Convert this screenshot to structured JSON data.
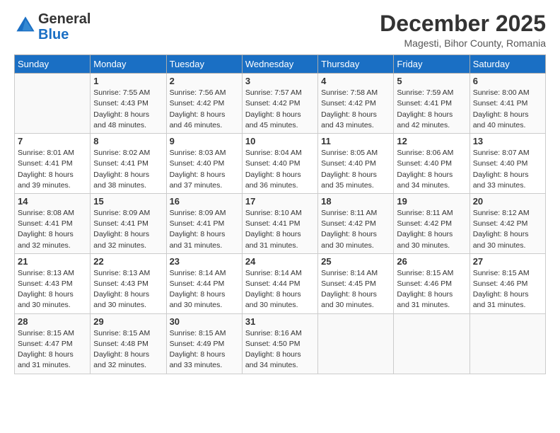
{
  "header": {
    "logo_line1": "General",
    "logo_line2": "Blue",
    "month_title": "December 2025",
    "subtitle": "Magesti, Bihor County, Romania"
  },
  "weekdays": [
    "Sunday",
    "Monday",
    "Tuesday",
    "Wednesday",
    "Thursday",
    "Friday",
    "Saturday"
  ],
  "weeks": [
    [
      {
        "day": "",
        "info": ""
      },
      {
        "day": "1",
        "info": "Sunrise: 7:55 AM\nSunset: 4:43 PM\nDaylight: 8 hours\nand 48 minutes."
      },
      {
        "day": "2",
        "info": "Sunrise: 7:56 AM\nSunset: 4:42 PM\nDaylight: 8 hours\nand 46 minutes."
      },
      {
        "day": "3",
        "info": "Sunrise: 7:57 AM\nSunset: 4:42 PM\nDaylight: 8 hours\nand 45 minutes."
      },
      {
        "day": "4",
        "info": "Sunrise: 7:58 AM\nSunset: 4:42 PM\nDaylight: 8 hours\nand 43 minutes."
      },
      {
        "day": "5",
        "info": "Sunrise: 7:59 AM\nSunset: 4:41 PM\nDaylight: 8 hours\nand 42 minutes."
      },
      {
        "day": "6",
        "info": "Sunrise: 8:00 AM\nSunset: 4:41 PM\nDaylight: 8 hours\nand 40 minutes."
      }
    ],
    [
      {
        "day": "7",
        "info": "Sunrise: 8:01 AM\nSunset: 4:41 PM\nDaylight: 8 hours\nand 39 minutes."
      },
      {
        "day": "8",
        "info": "Sunrise: 8:02 AM\nSunset: 4:41 PM\nDaylight: 8 hours\nand 38 minutes."
      },
      {
        "day": "9",
        "info": "Sunrise: 8:03 AM\nSunset: 4:40 PM\nDaylight: 8 hours\nand 37 minutes."
      },
      {
        "day": "10",
        "info": "Sunrise: 8:04 AM\nSunset: 4:40 PM\nDaylight: 8 hours\nand 36 minutes."
      },
      {
        "day": "11",
        "info": "Sunrise: 8:05 AM\nSunset: 4:40 PM\nDaylight: 8 hours\nand 35 minutes."
      },
      {
        "day": "12",
        "info": "Sunrise: 8:06 AM\nSunset: 4:40 PM\nDaylight: 8 hours\nand 34 minutes."
      },
      {
        "day": "13",
        "info": "Sunrise: 8:07 AM\nSunset: 4:40 PM\nDaylight: 8 hours\nand 33 minutes."
      }
    ],
    [
      {
        "day": "14",
        "info": "Sunrise: 8:08 AM\nSunset: 4:41 PM\nDaylight: 8 hours\nand 32 minutes."
      },
      {
        "day": "15",
        "info": "Sunrise: 8:09 AM\nSunset: 4:41 PM\nDaylight: 8 hours\nand 32 minutes."
      },
      {
        "day": "16",
        "info": "Sunrise: 8:09 AM\nSunset: 4:41 PM\nDaylight: 8 hours\nand 31 minutes."
      },
      {
        "day": "17",
        "info": "Sunrise: 8:10 AM\nSunset: 4:41 PM\nDaylight: 8 hours\nand 31 minutes."
      },
      {
        "day": "18",
        "info": "Sunrise: 8:11 AM\nSunset: 4:42 PM\nDaylight: 8 hours\nand 30 minutes."
      },
      {
        "day": "19",
        "info": "Sunrise: 8:11 AM\nSunset: 4:42 PM\nDaylight: 8 hours\nand 30 minutes."
      },
      {
        "day": "20",
        "info": "Sunrise: 8:12 AM\nSunset: 4:42 PM\nDaylight: 8 hours\nand 30 minutes."
      }
    ],
    [
      {
        "day": "21",
        "info": "Sunrise: 8:13 AM\nSunset: 4:43 PM\nDaylight: 8 hours\nand 30 minutes."
      },
      {
        "day": "22",
        "info": "Sunrise: 8:13 AM\nSunset: 4:43 PM\nDaylight: 8 hours\nand 30 minutes."
      },
      {
        "day": "23",
        "info": "Sunrise: 8:14 AM\nSunset: 4:44 PM\nDaylight: 8 hours\nand 30 minutes."
      },
      {
        "day": "24",
        "info": "Sunrise: 8:14 AM\nSunset: 4:44 PM\nDaylight: 8 hours\nand 30 minutes."
      },
      {
        "day": "25",
        "info": "Sunrise: 8:14 AM\nSunset: 4:45 PM\nDaylight: 8 hours\nand 30 minutes."
      },
      {
        "day": "26",
        "info": "Sunrise: 8:15 AM\nSunset: 4:46 PM\nDaylight: 8 hours\nand 31 minutes."
      },
      {
        "day": "27",
        "info": "Sunrise: 8:15 AM\nSunset: 4:46 PM\nDaylight: 8 hours\nand 31 minutes."
      }
    ],
    [
      {
        "day": "28",
        "info": "Sunrise: 8:15 AM\nSunset: 4:47 PM\nDaylight: 8 hours\nand 31 minutes."
      },
      {
        "day": "29",
        "info": "Sunrise: 8:15 AM\nSunset: 4:48 PM\nDaylight: 8 hours\nand 32 minutes."
      },
      {
        "day": "30",
        "info": "Sunrise: 8:15 AM\nSunset: 4:49 PM\nDaylight: 8 hours\nand 33 minutes."
      },
      {
        "day": "31",
        "info": "Sunrise: 8:16 AM\nSunset: 4:50 PM\nDaylight: 8 hours\nand 34 minutes."
      },
      {
        "day": "",
        "info": ""
      },
      {
        "day": "",
        "info": ""
      },
      {
        "day": "",
        "info": ""
      }
    ]
  ]
}
